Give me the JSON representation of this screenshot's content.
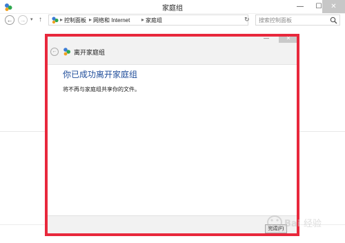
{
  "window": {
    "title": "家庭组",
    "minimize_glyph": "—",
    "maximize_glyph": "☐",
    "close_glyph": "✕"
  },
  "addressbar": {
    "back_glyph": "←",
    "forward_glyph": "→",
    "recent_glyph": "▾",
    "up_glyph": "↑",
    "breadcrumb_sep": "▸",
    "breadcrumbs": [
      "控制面板",
      "网络和 Internet",
      "家庭组"
    ],
    "dropdown_glyph": "▾",
    "refresh_glyph": "↻",
    "search_placeholder": "搜索控制面板"
  },
  "dialog": {
    "title": "离开家庭组",
    "back_glyph": "←",
    "minimize_glyph": "—",
    "close_glyph": "✕",
    "heading": "你已成功离开家庭组",
    "body": "将不再与家庭组共享你的文件。",
    "finish_button": "完成(F)"
  },
  "watermark": {
    "text": "Baidu 经验"
  },
  "colors": {
    "highlight": "#e8283c",
    "heading": "#1e4c9a",
    "dialog_chrome": "#f2f2f2"
  },
  "icons": {
    "app": "homegroup-icon",
    "address": "homegroup-icon",
    "search": "search-icon",
    "dialog": "homegroup-icon"
  }
}
